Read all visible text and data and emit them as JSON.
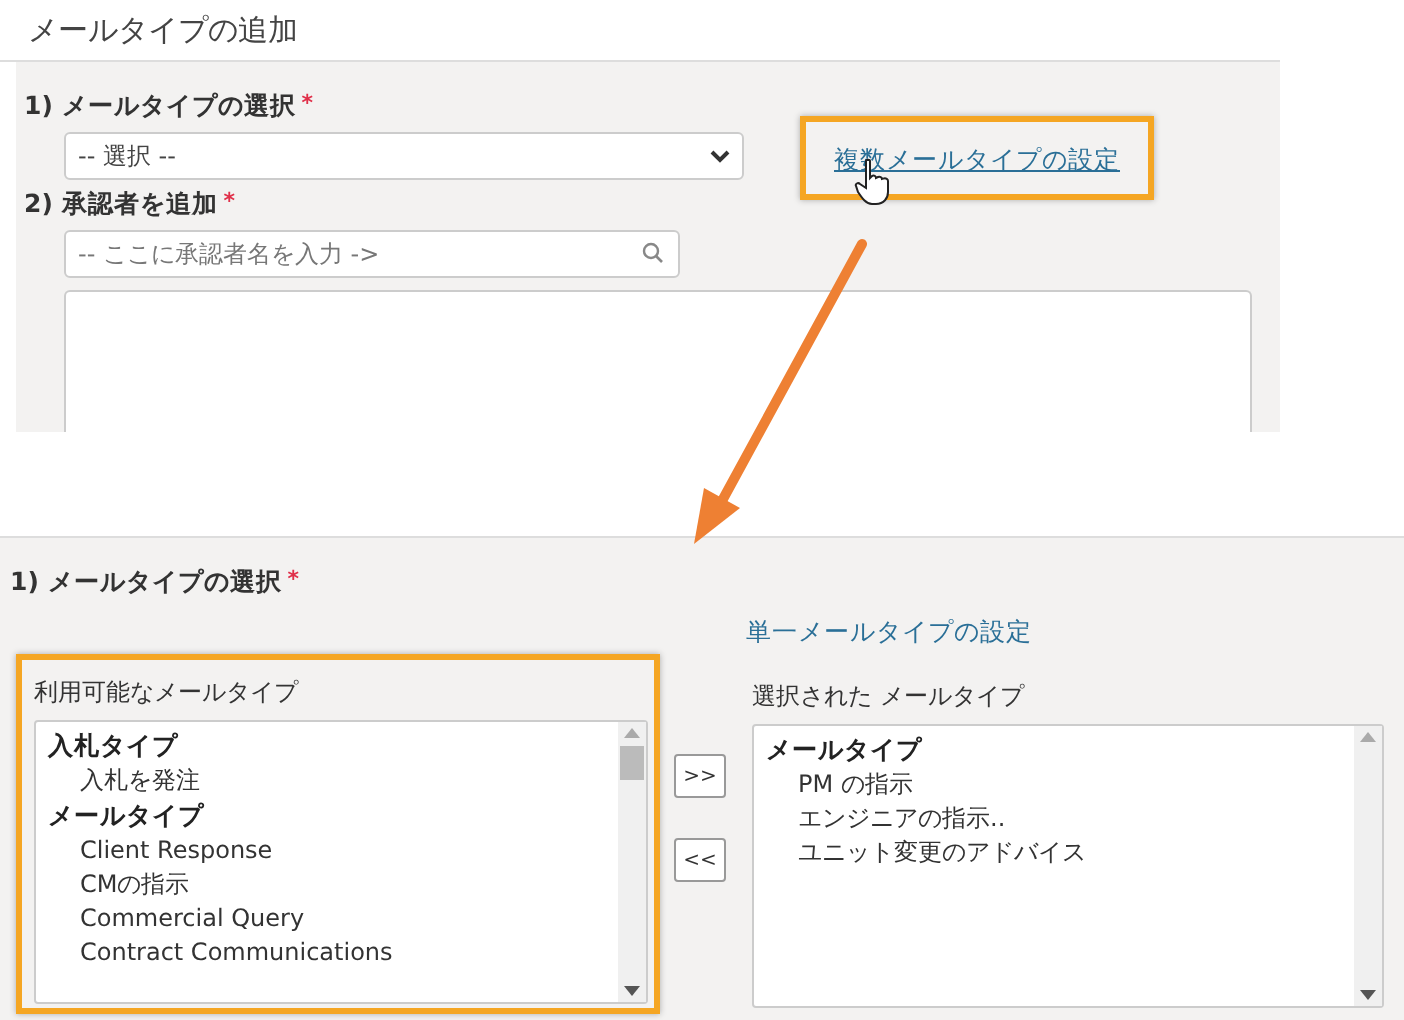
{
  "top_panel": {
    "title": "メールタイプの追加",
    "mail_type_label": "1) メールタイプの選択",
    "mail_type_required": "*",
    "mail_type_select": {
      "value": "-- 選択 --"
    },
    "multi_link": "複数メールタイプの設定",
    "approver_label": "2) 承認者を追加",
    "approver_required": "*",
    "approver_search": {
      "placeholder": "-- ここに承認者名を入力 ->"
    }
  },
  "bottom_panel": {
    "mail_type_label": "1) メールタイプの選択",
    "mail_type_required": "*",
    "single_link": "単一メールタイプの設定",
    "available": {
      "label": "利用可能なメールタイプ",
      "groups": [
        {
          "name": "入札タイプ",
          "items": [
            "入札を発注"
          ]
        },
        {
          "name": "メールタイプ",
          "items": [
            "Client Response",
            "CMの指示",
            "Commercial Query",
            "Contract Communications"
          ]
        }
      ]
    },
    "move_buttons": [
      ">>",
      "<<"
    ],
    "selected": {
      "label": "選択された メールタイプ",
      "groups": [
        {
          "name": "メールタイプ",
          "items": [
            "PM の指示",
            "エンジニアの指示..",
            "ユニット変更のアドバイス"
          ]
        }
      ]
    }
  }
}
